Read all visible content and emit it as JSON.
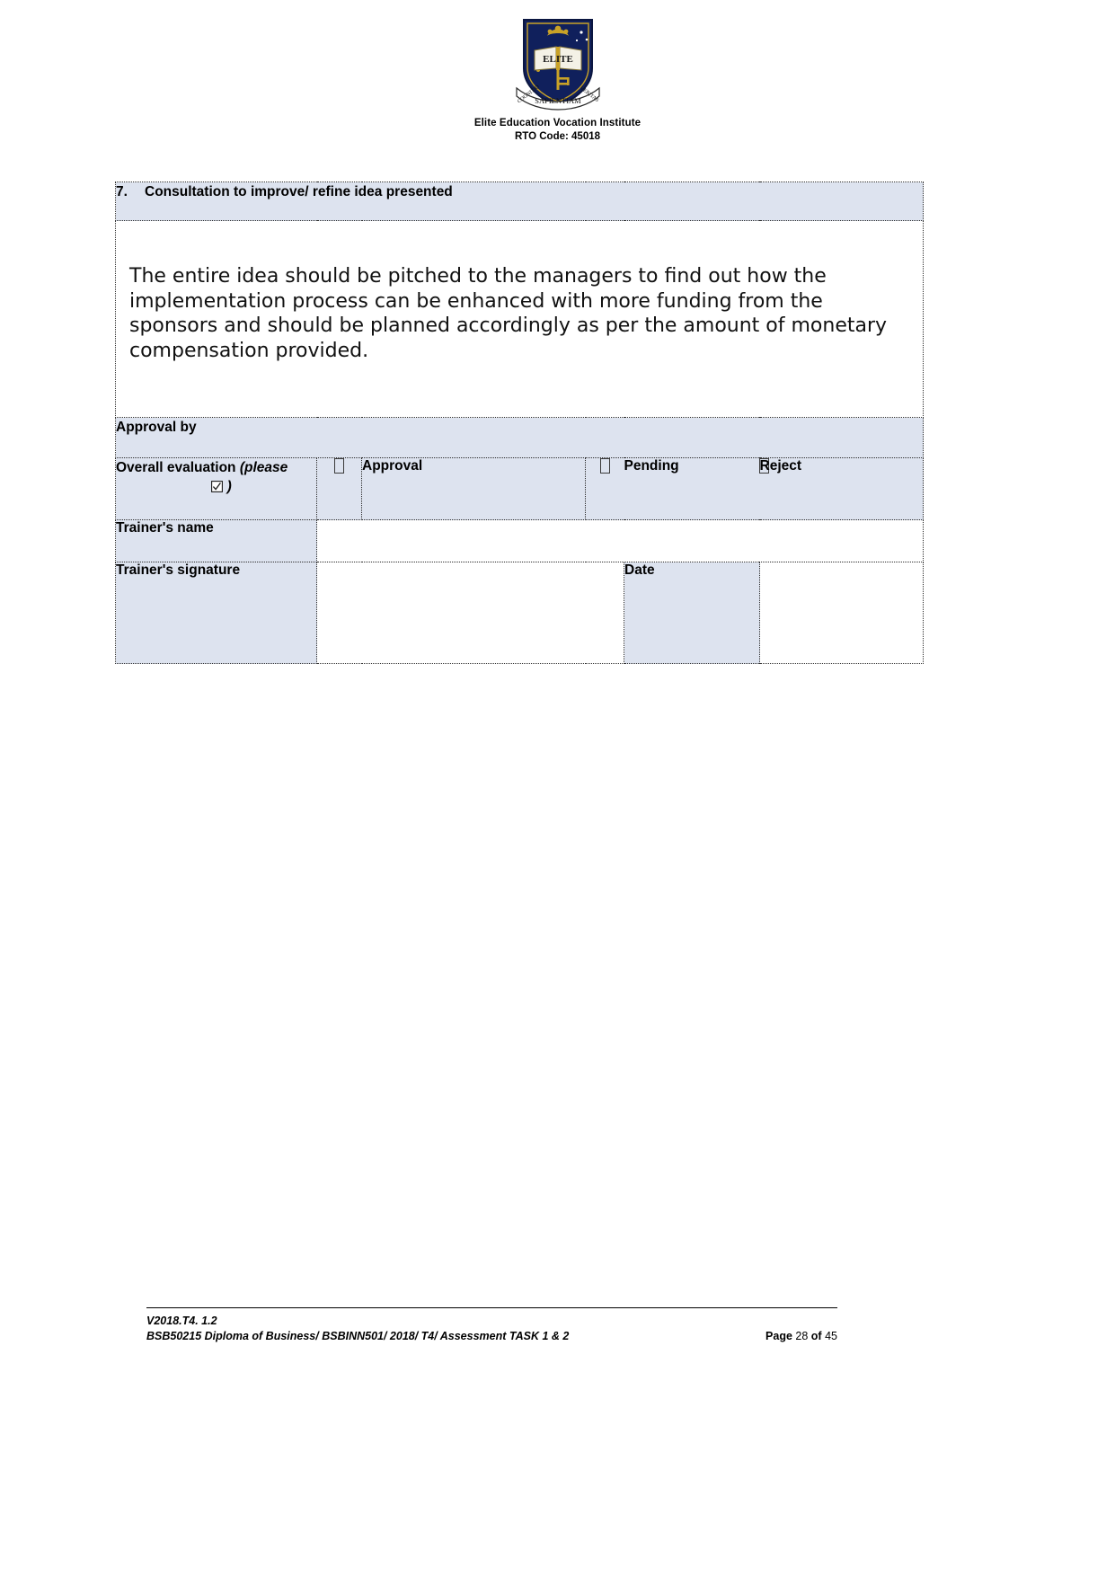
{
  "header": {
    "logo_alt": "elite-crest-logo",
    "crest_motto_left": "COGNITIO",
    "crest_motto_right": "VERITAS",
    "crest_motto_bottom": "SAPIENTIAM",
    "crest_word": "ELITE",
    "org_name": "Elite Education Vocation Institute",
    "rto_code": "RTO Code: 45018"
  },
  "form": {
    "section": {
      "number": "7.",
      "title": "Consultation to improve/ refine idea presented"
    },
    "answer": "The entire idea should be pitched to the managers to find out how the implementation process can be enhanced with more funding from the sponsors and should be planned accordingly as per the amount of monetary compensation provided.",
    "approval_heading": "Approval by",
    "evaluation": {
      "label_main": "Overall evaluation",
      "label_italic_open": "(please",
      "label_italic_close": ")",
      "tick_icon": "checked-box-icon",
      "options": [
        {
          "checkbox": "empty-checkbox-icon",
          "label": "Approval"
        },
        {
          "checkbox": "empty-checkbox-icon",
          "label": "Pending"
        },
        {
          "checkbox": "empty-checkbox-icon",
          "label": "Reject"
        }
      ]
    },
    "trainer_name_label": "Trainer's name",
    "trainer_name_value": "",
    "trainer_signature_label": "Trainer's signature",
    "trainer_signature_value": "",
    "date_label": "Date",
    "date_value": ""
  },
  "footer": {
    "version": "V2018.T4. 1.2",
    "course_line": "BSB50215 Diploma of Business/ BSBINN501/ 2018/ T4/ Assessment TASK 1 & 2",
    "page_prefix": "Page",
    "page_number": "28",
    "page_of": "of",
    "page_total": "45"
  },
  "colors": {
    "shade": "#dde3ef",
    "border": "#2b2b2b",
    "crest_navy": "#10205c",
    "crest_gold": "#c9a227"
  }
}
